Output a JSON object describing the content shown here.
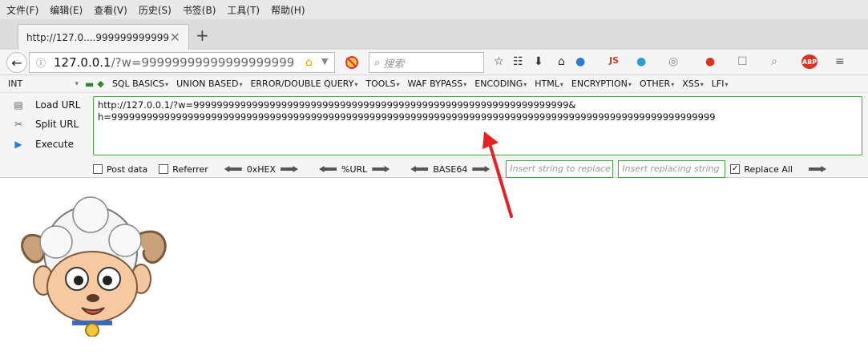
{
  "menubar": {
    "items": [
      "文件(F)",
      "编辑(E)",
      "查看(V)",
      "历史(S)",
      "书签(B)",
      "工具(T)",
      "帮助(H)"
    ]
  },
  "tabs": {
    "active_title": "http://127.0....999999999999",
    "close_glyph": "✕",
    "new_tab_glyph": "+"
  },
  "navbar": {
    "url_host": "127.0.0.1",
    "url_rest": "/?w=99999999999999999999",
    "search_placeholder": "搜索"
  },
  "hackbar": {
    "select_value": "INT",
    "menus": [
      "SQL BASICS",
      "UNION BASED",
      "ERROR/DOUBLE QUERY",
      "TOOLS",
      "WAF BYPASS",
      "ENCODING",
      "HTML",
      "ENCRYPTION",
      "OTHER",
      "XSS",
      "LFI"
    ],
    "actions": [
      {
        "label": "Load URL",
        "icon": "load-url-icon"
      },
      {
        "label": "Split URL",
        "icon": "split-url-icon"
      },
      {
        "label": "Execute",
        "icon": "execute-icon"
      }
    ],
    "url_text": "http://127.0.0.1/?w=9999999999999999999999999999999999999999999999999999999999999999&\nh=9999999999999999999999999999999999999999999999999999999999999999999999999999999999999999999999999999999",
    "post_data_label": "Post data",
    "referrer_label": "Referrer",
    "enc_hex": "0xHEX",
    "enc_url": "%URL",
    "enc_b64": "BASE64",
    "replace_placeholder": "Insert string to replace",
    "replacing_placeholder": "Insert replacing string",
    "replace_all_label": "Replace All",
    "replace_all_checked": true
  },
  "colors": {
    "accent_green": "#3fa83f",
    "annotation_red": "#e52222"
  }
}
